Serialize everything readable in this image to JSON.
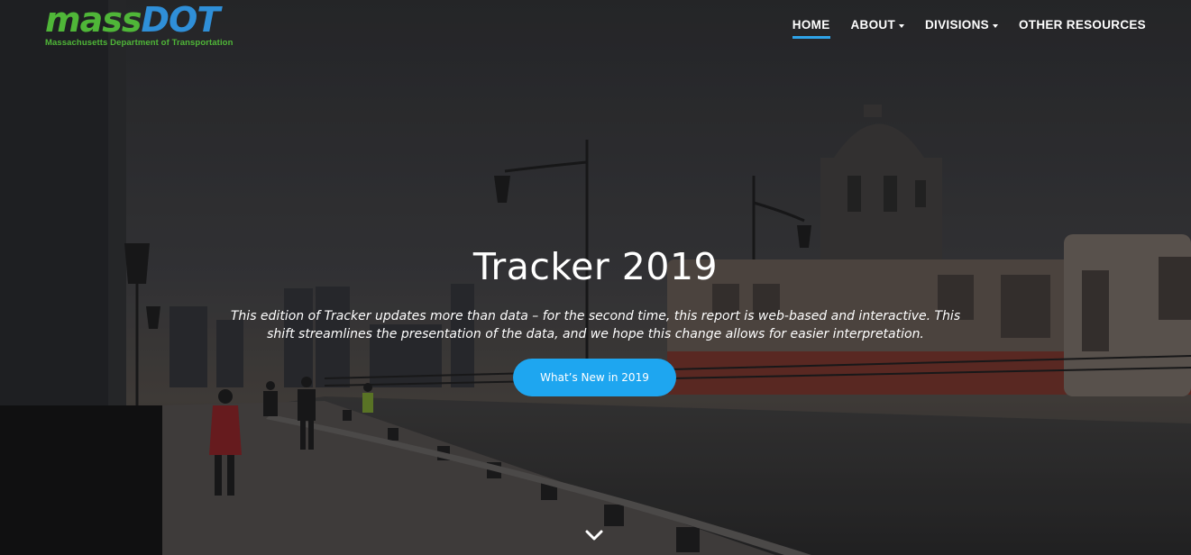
{
  "logo": {
    "word_mass": "mass",
    "word_dot": "DOT",
    "subtitle": "Massachusetts Department of Transportation"
  },
  "nav": {
    "items": [
      {
        "label": "HOME",
        "active": true,
        "has_dropdown": false
      },
      {
        "label": "ABOUT",
        "active": false,
        "has_dropdown": true
      },
      {
        "label": "DIVISIONS",
        "active": false,
        "has_dropdown": true
      },
      {
        "label": "OTHER RESOURCES",
        "active": false,
        "has_dropdown": false
      }
    ]
  },
  "hero": {
    "title": "Tracker 2019",
    "description": "This edition of Tracker updates more than data – for the second time, this report is web-based and interactive. This shift streamlines the presentation of the data, and we hope this change allows for easier interpretation.",
    "cta_label": "What’s New in 2019",
    "scroll_icon": "chevron-down-icon"
  },
  "colors": {
    "brand_green": "#4fb638",
    "brand_blue": "#2f8fd8",
    "accent": "#1ea6f0",
    "nav_underline": "#2fa3e8"
  }
}
